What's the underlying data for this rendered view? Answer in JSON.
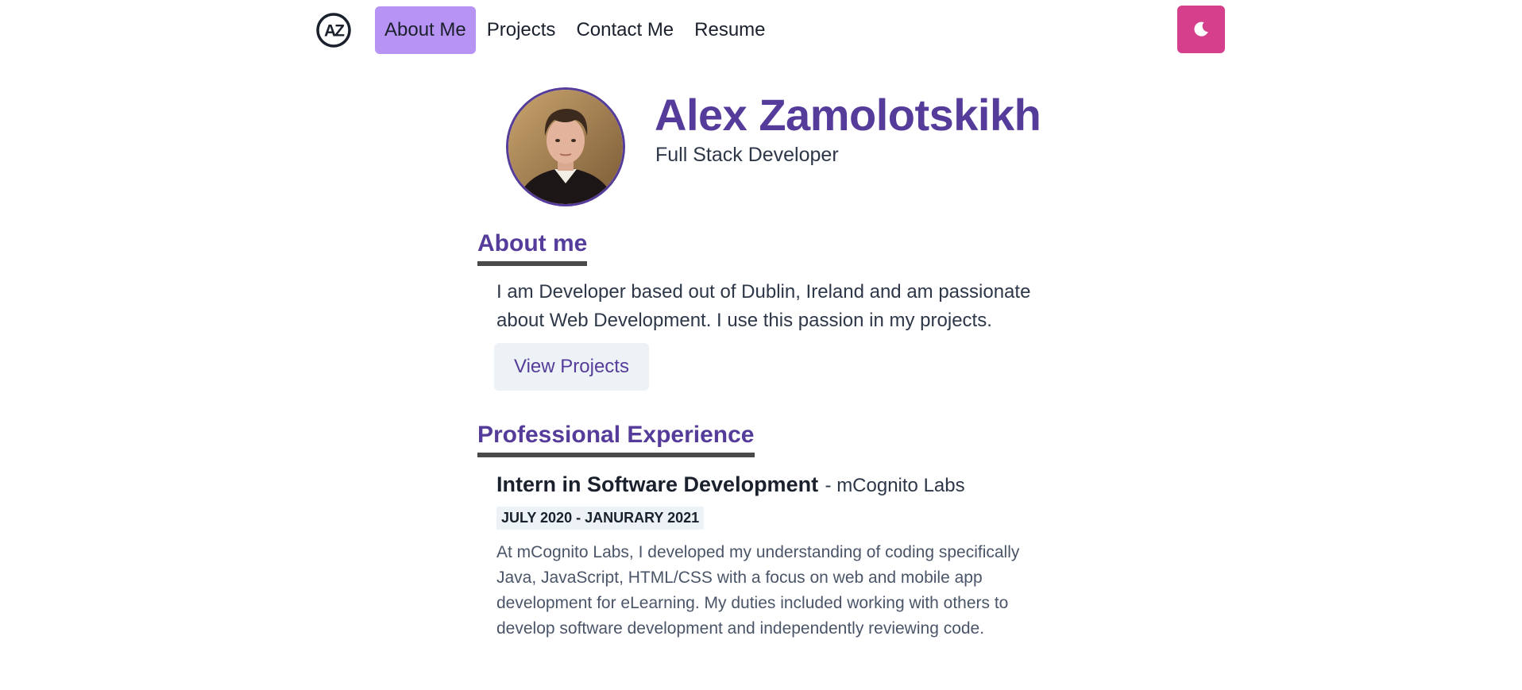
{
  "nav": {
    "logo_text": "AZ",
    "links": [
      {
        "label": "About Me",
        "active": true
      },
      {
        "label": "Projects",
        "active": false
      },
      {
        "label": "Contact Me",
        "active": false
      },
      {
        "label": "Resume",
        "active": false
      }
    ],
    "theme_toggle_icon": "moon-icon"
  },
  "hero": {
    "name": "Alex Zamolotskikh",
    "role": "Full Stack Developer"
  },
  "about": {
    "heading": "About me",
    "text": "I am Developer based out of Dublin, Ireland and am passionate about Web Development. I use this passion in my projects.",
    "button_label": "View Projects"
  },
  "experience": {
    "heading": "Professional Experience",
    "jobs": [
      {
        "title": "Intern in Software Development",
        "company": "- mCognito Labs",
        "dates": "JULY 2020 - JANURARY 2021",
        "description": "At mCognito Labs, I developed my understanding of coding specifically Java, JavaScript, HTML/CSS with a focus on web and mobile app development for eLearning. My duties included working with others to develop software development and independently reviewing code."
      }
    ]
  },
  "colors": {
    "accent": "#553c9a",
    "active_nav": "#b794f4",
    "toggle": "#d53f8c",
    "button_bg": "#edf2f7"
  }
}
